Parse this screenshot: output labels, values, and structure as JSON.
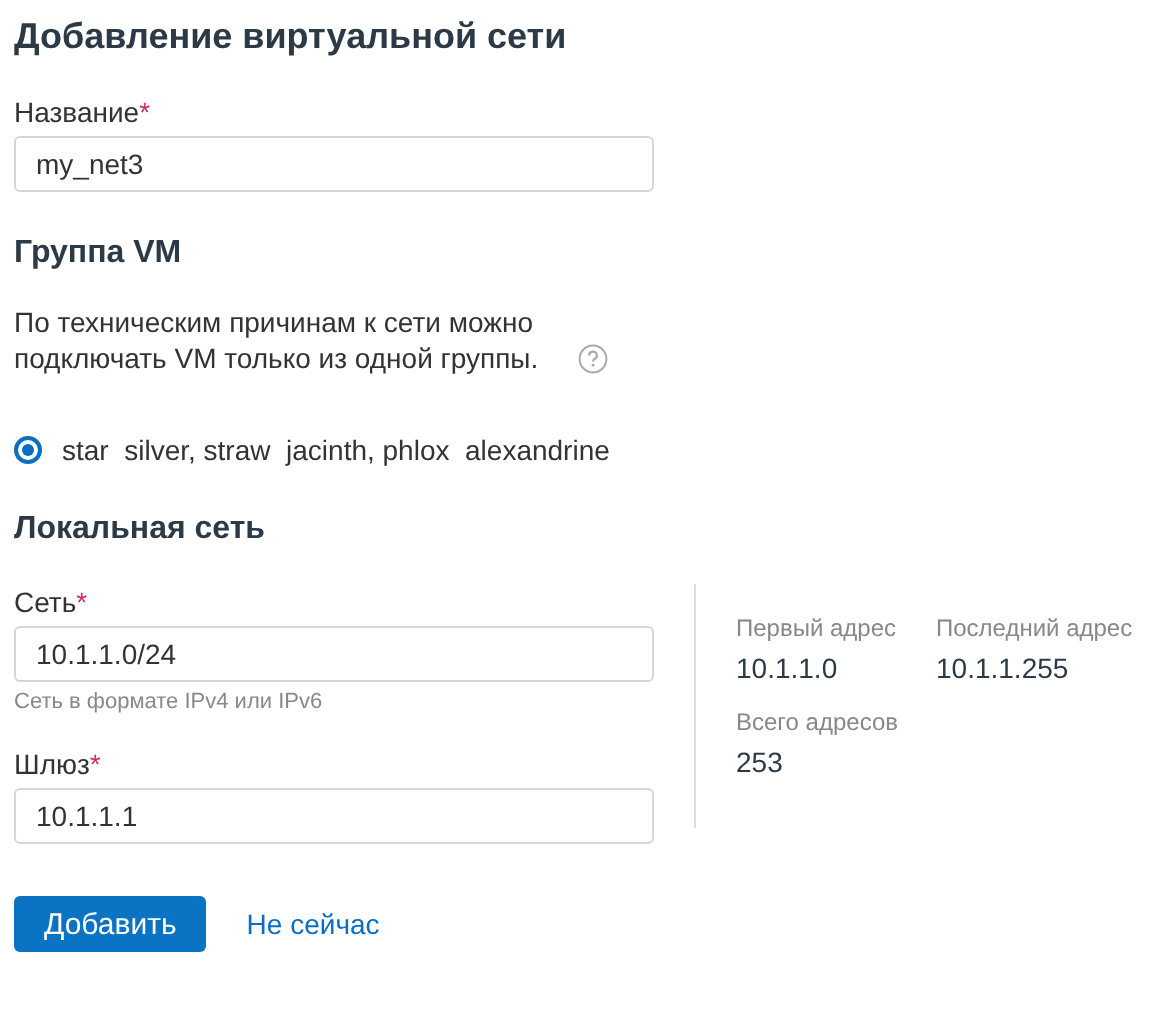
{
  "title": "Добавление виртуальной сети",
  "name_field": {
    "label": "Название",
    "required_mark": "*",
    "value": "my_net3"
  },
  "vm_group": {
    "heading": "Группа VM",
    "note": "По техническим причинам к сети можно подключать VM только из одной группы.",
    "options": [
      {
        "label": "star  silver, straw  jacinth, phlox  alexandrine",
        "selected": true
      }
    ]
  },
  "local_network": {
    "heading": "Локальная сеть",
    "network_field": {
      "label": "Сеть",
      "required_mark": "*",
      "value": "10.1.1.0/24",
      "hint": "Сеть в формате IPv4 или IPv6"
    },
    "gateway_field": {
      "label": "Шлюз",
      "required_mark": "*",
      "value": "10.1.1.1"
    },
    "stats": [
      {
        "label": "Первый адрес",
        "value": "10.1.1.0"
      },
      {
        "label": "Последний адрес",
        "value": "10.1.1.255"
      },
      {
        "label": "Всего адресов",
        "value": "253"
      }
    ]
  },
  "buttons": {
    "primary": "Добавить",
    "secondary": "Не сейчас"
  }
}
